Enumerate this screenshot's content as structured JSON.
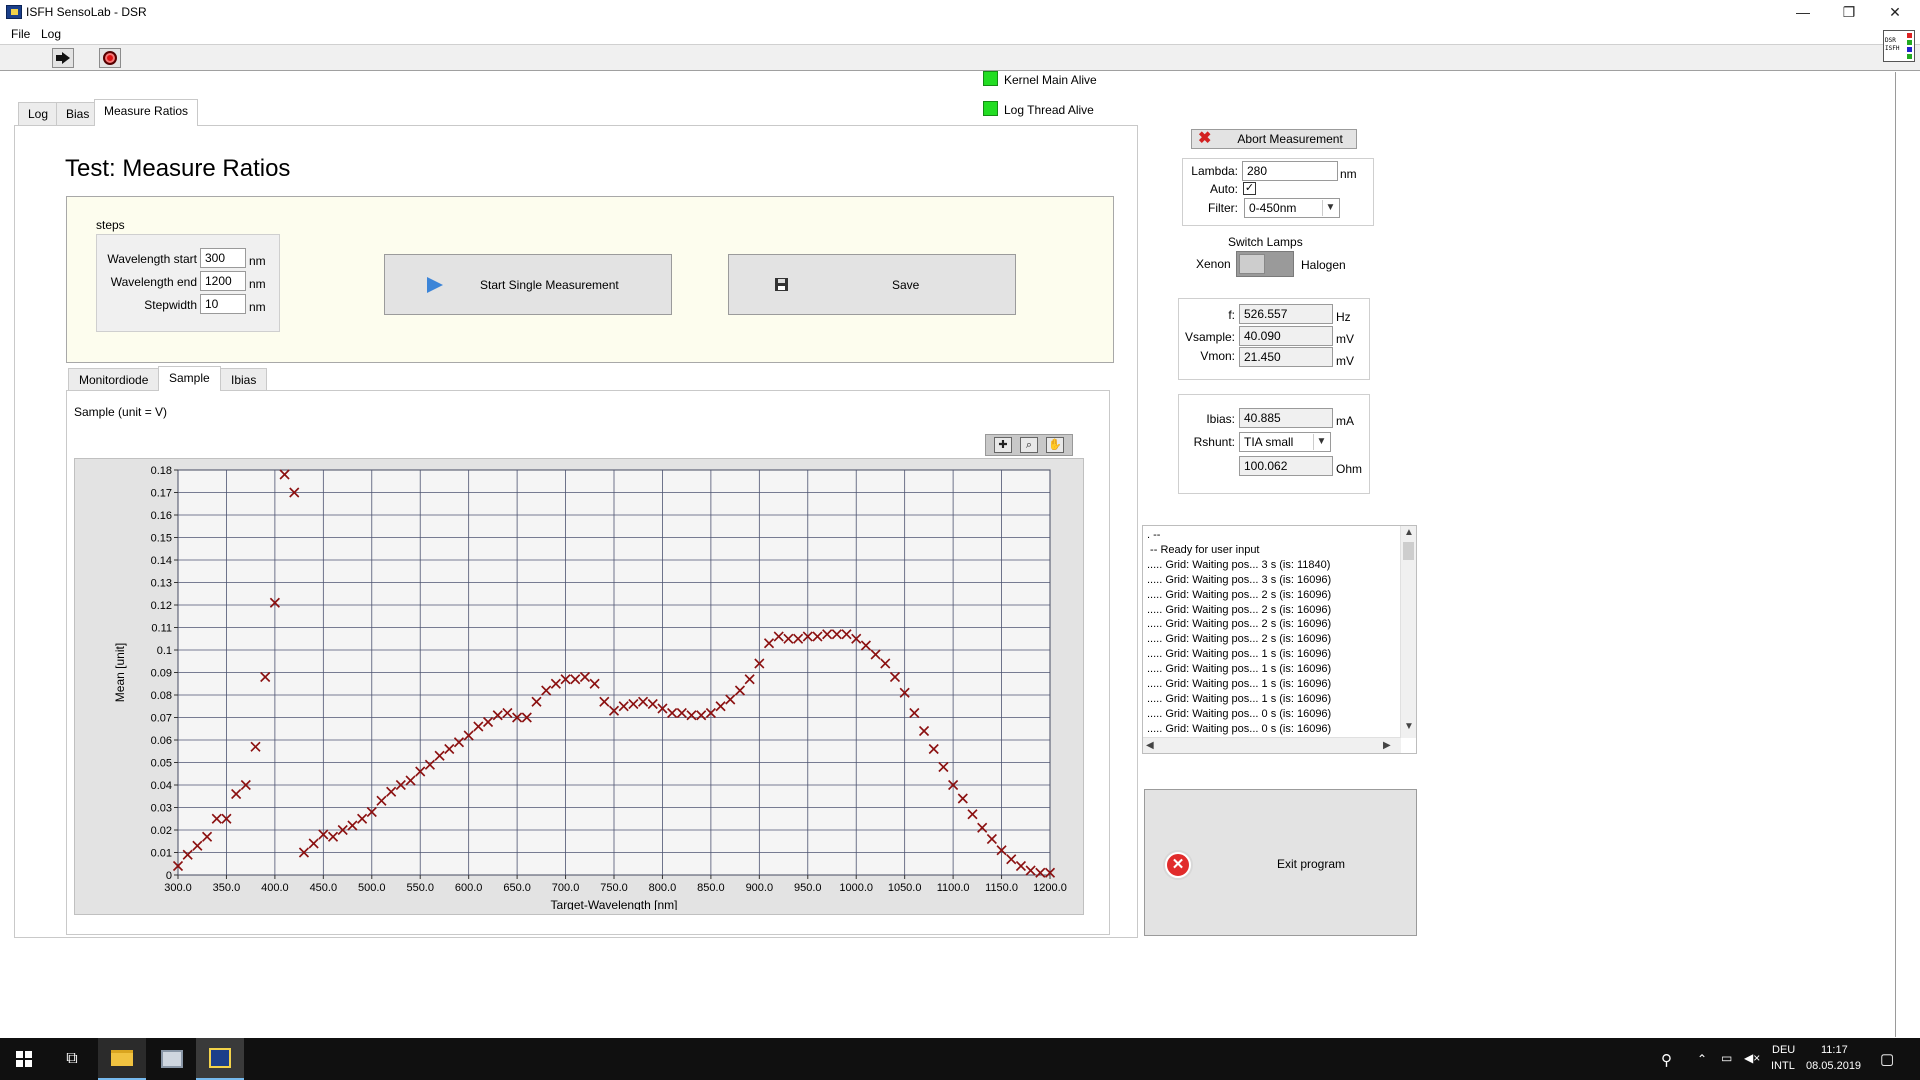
{
  "window": {
    "title": "ISFH SensoLab - DSR",
    "controls": {
      "minimize": "—",
      "maximize": "❐",
      "close": "✕"
    }
  },
  "menu": [
    "File",
    "Log"
  ],
  "toolbar": {
    "logo_lines": [
      "DSR",
      "ISFH"
    ]
  },
  "status": {
    "kernel": "Kernel Main Alive",
    "log_thread": "Log Thread Alive"
  },
  "tabs": [
    "Log",
    "Bias",
    "Measure Ratios"
  ],
  "page_title": "Test: Measure Ratios",
  "steps": {
    "label": "steps",
    "fields": [
      {
        "label": "Wavelength start",
        "value": "300",
        "unit": "nm"
      },
      {
        "label": "Wavelength end",
        "value": "1200",
        "unit": "nm"
      },
      {
        "label": "Stepwidth",
        "value": "10",
        "unit": "nm"
      }
    ]
  },
  "buttons": {
    "start": "Start Single Measurement",
    "save": "Save",
    "abort": "Abort Measurement",
    "exit": "Exit program"
  },
  "inner_tabs": [
    "Monitordiode",
    "Sample",
    "Ibias"
  ],
  "graph_label": "Sample (unit = V)",
  "lamp": {
    "lambda_label": "Lambda:",
    "lambda_value": "280",
    "lambda_unit": "nm",
    "auto_label": "Auto:",
    "auto_checked": "✓",
    "filter_label": "Filter:",
    "filter_value": "0-450nm"
  },
  "switch_lamps": {
    "title": "Switch Lamps",
    "left": "Xenon",
    "right": "Halogen"
  },
  "readouts": [
    {
      "label": "f:",
      "value": "526.557",
      "unit": "Hz"
    },
    {
      "label": "Vsample:",
      "value": "40.090",
      "unit": "mV"
    },
    {
      "label": "Vmon:",
      "value": "21.450",
      "unit": "mV"
    }
  ],
  "bias": {
    "ibias_label": "Ibias:",
    "ibias_value": "40.885",
    "ibias_unit": "mA",
    "rshunt_label": "Rshunt:",
    "rshunt_value": "TIA small",
    "ohm_value": "100.062",
    "ohm_unit": "Ohm"
  },
  "log_lines": [
    ". --",
    " -- Ready for user input",
    "..... Grid: Waiting pos... 3 s (is: 11840)",
    "..... Grid: Waiting pos... 3 s (is: 16096)",
    "..... Grid: Waiting pos... 2 s (is: 16096)",
    "..... Grid: Waiting pos... 2 s (is: 16096)",
    "..... Grid: Waiting pos... 2 s (is: 16096)",
    "..... Grid: Waiting pos... 2 s (is: 16096)",
    "..... Grid: Waiting pos... 1 s (is: 16096)",
    "..... Grid: Waiting pos... 1 s (is: 16096)",
    "..... Grid: Waiting pos... 1 s (is: 16096)",
    "..... Grid: Waiting pos... 1 s (is: 16096)",
    "..... Grid: Waiting pos... 0 s (is: 16096)",
    "..... Grid: Waiting pos... 0 s (is: 16096)"
  ],
  "taskbar": {
    "lang_top": "DEU",
    "lang_bottom": "INTL",
    "time": "11:17",
    "date": "08.05.2019"
  },
  "colors": {
    "marker": "#8b1010",
    "plot_bg": "#f5f5f5",
    "grid": "#4d5370",
    "led": "#22dd22"
  },
  "icons": [
    "run-arrow-icon",
    "stop-icon",
    "play-icon",
    "floppy-icon",
    "abort-x-icon",
    "exit-icon",
    "zoom-icon",
    "pan-icon",
    "cursor-icon"
  ],
  "chart_data": {
    "type": "scatter",
    "title": "",
    "xlabel": "Target-Wavelength [nm]",
    "ylabel": "Mean [unit]",
    "xlim": [
      300,
      1200
    ],
    "ylim": [
      0,
      0.18
    ],
    "xticks": [
      "300.0",
      "350.0",
      "400.0",
      "450.0",
      "500.0",
      "550.0",
      "600.0",
      "650.0",
      "700.0",
      "750.0",
      "800.0",
      "850.0",
      "900.0",
      "950.0",
      "1000.0",
      "1050.0",
      "1100.0",
      "1150.0",
      "1200.0"
    ],
    "yticks": [
      "0",
      "0.01",
      "0.02",
      "0.03",
      "0.04",
      "0.05",
      "0.06",
      "0.07",
      "0.08",
      "0.09",
      "0.1",
      "0.11",
      "0.12",
      "0.13",
      "0.14",
      "0.15",
      "0.16",
      "0.17",
      "0.18"
    ],
    "grid": true,
    "marker": "x",
    "series": [
      {
        "x": [
          300,
          310,
          320,
          330,
          340,
          350,
          360,
          370,
          380,
          390,
          400,
          410,
          420,
          430,
          440,
          450,
          460,
          470,
          480,
          490,
          500,
          510,
          520,
          530,
          540,
          550,
          560,
          570,
          580,
          590,
          600,
          610,
          620,
          630,
          640,
          650,
          660,
          670,
          680,
          690,
          700,
          710,
          720,
          730,
          740,
          750,
          760,
          770,
          780,
          790,
          800,
          810,
          820,
          830,
          840,
          850,
          860,
          870,
          880,
          890,
          900,
          910,
          920,
          930,
          940,
          950,
          960,
          970,
          980,
          990,
          1000,
          1010,
          1020,
          1030,
          1040,
          1050,
          1060,
          1070,
          1080,
          1090,
          1100,
          1110,
          1120,
          1130,
          1140,
          1150,
          1160,
          1170,
          1180,
          1190,
          1200
        ],
        "y": [
          0.004,
          0.009,
          0.013,
          0.017,
          0.025,
          0.025,
          0.036,
          0.04,
          0.057,
          0.088,
          0.121,
          0.178,
          0.17,
          0.01,
          0.014,
          0.018,
          0.017,
          0.02,
          0.022,
          0.025,
          0.028,
          0.033,
          0.037,
          0.04,
          0.042,
          0.046,
          0.049,
          0.053,
          0.056,
          0.059,
          0.062,
          0.066,
          0.068,
          0.071,
          0.072,
          0.07,
          0.07,
          0.077,
          0.082,
          0.085,
          0.087,
          0.087,
          0.088,
          0.085,
          0.077,
          0.073,
          0.075,
          0.076,
          0.077,
          0.076,
          0.074,
          0.072,
          0.072,
          0.071,
          0.071,
          0.072,
          0.075,
          0.078,
          0.082,
          0.087,
          0.094,
          0.103,
          0.106,
          0.105,
          0.105,
          0.106,
          0.106,
          0.107,
          0.107,
          0.107,
          0.105,
          0.102,
          0.098,
          0.094,
          0.088,
          0.081,
          0.072,
          0.064,
          0.056,
          0.048,
          0.04,
          0.034,
          0.027,
          0.021,
          0.016,
          0.011,
          0.007,
          0.004,
          0.002,
          0.001,
          0.001
        ]
      }
    ]
  }
}
